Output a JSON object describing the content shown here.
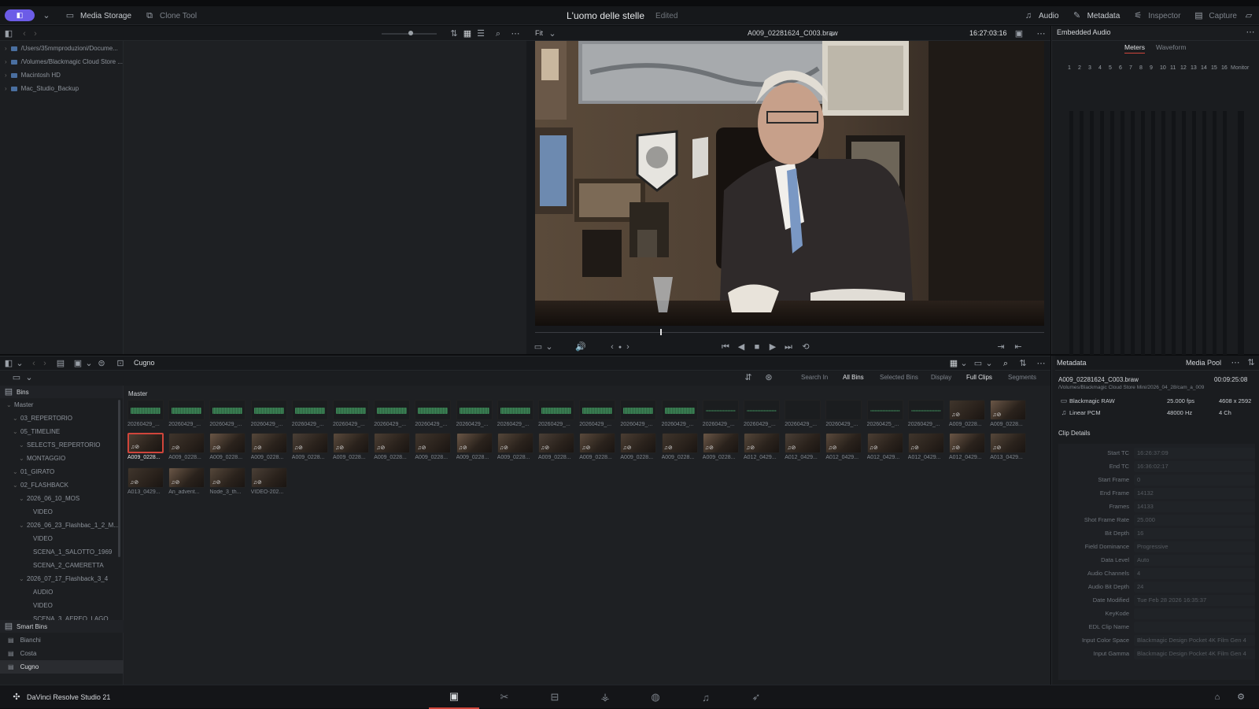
{
  "topbar": {
    "media_storage": "Media Storage",
    "clone_tool": "Clone Tool",
    "project_title": "L'uomo delle stelle",
    "edited": "Edited",
    "audio": "Audio",
    "metadata": "Metadata",
    "inspector": "Inspector",
    "capture": "Capture"
  },
  "viewer": {
    "fit": "Fit",
    "clip_name": "A009_02281624_C003.braw",
    "timecode": "16:27:03:16"
  },
  "storage": {
    "items": [
      "/Users/35mmproduzioni/Docume...",
      "/Volumes/Blackmagic Cloud Store ...",
      "Macintosh HD",
      "Mac_Studio_Backup"
    ]
  },
  "audio": {
    "title": "Embedded Audio",
    "tab_meters": "Meters",
    "tab_waveform": "Waveform",
    "monitor": "Monitor",
    "channels": [
      "1",
      "2",
      "3",
      "4",
      "5",
      "6",
      "7",
      "8",
      "9",
      "10",
      "11",
      "12",
      "13",
      "14",
      "15",
      "16"
    ]
  },
  "pool": {
    "bin_name": "Cugno",
    "master": "Master",
    "search_in": "Search In",
    "all_bins": "All Bins",
    "selected_bins": "Selected Bins",
    "display": "Display",
    "full_clips": "Full Clips",
    "segments": "Segments",
    "row1": [
      "20260429_...",
      "20260429_...",
      "20260429_...",
      "20260429_...",
      "20260429_...",
      "20260429_...",
      "20260429_...",
      "20260429_...",
      "20260429_...",
      "20260429_...",
      "20260429_...",
      "20260429_...",
      "20260429_...",
      "20260429_...",
      "20260429_...",
      "20260429_...",
      "20260429_...",
      "20260429_...",
      "20260425_...",
      "20260429_...",
      "A009_0228...",
      "A009_0228..."
    ],
    "row2": [
      "A009_0228...",
      "A009_0228...",
      "A009_0228...",
      "A009_0228...",
      "A009_0228...",
      "A009_0228...",
      "A009_0228...",
      "A009_0228...",
      "A009_0228...",
      "A009_0228...",
      "A009_0228...",
      "A009_0228...",
      "A009_0228...",
      "A009_0228...",
      "A009_0228...",
      "A012_0429...",
      "A012_0429...",
      "A012_0429...",
      "A012_0429...",
      "A012_0429...",
      "A012_0429...",
      "A013_0429..."
    ],
    "row3": [
      "A013_0429...",
      "An_advent...",
      "Node_3_th...",
      "VIDEO-202..."
    ]
  },
  "bins": {
    "header": "Bins",
    "items": [
      {
        "label": "Master",
        "indent": 0
      },
      {
        "label": "03_REPERTORIO",
        "indent": 1
      },
      {
        "label": "05_TIMELINE",
        "indent": 1
      },
      {
        "label": "SELECTS_REPERTORIO",
        "indent": 2
      },
      {
        "label": "MONTAGGIO",
        "indent": 2
      },
      {
        "label": "01_GIRATO",
        "indent": 1
      },
      {
        "label": "02_FLASHBACK",
        "indent": 1
      },
      {
        "label": "2026_06_10_MOS",
        "indent": 2
      },
      {
        "label": "VIDEO",
        "indent": 3
      },
      {
        "label": "2026_06_23_Flashbac_1_2_M...",
        "indent": 2
      },
      {
        "label": "VIDEO",
        "indent": 3
      },
      {
        "label": "SCENA_1_SALOTTO_1969",
        "indent": 3
      },
      {
        "label": "SCENA_2_CAMERETTA",
        "indent": 3
      },
      {
        "label": "2026_07_17_Flashback_3_4",
        "indent": 2
      },
      {
        "label": "AUDIO",
        "indent": 3
      },
      {
        "label": "VIDEO",
        "indent": 3
      },
      {
        "label": "SCENA_3_AEREO_LAGO",
        "indent": 3
      }
    ],
    "smart_header": "Smart Bins",
    "smart": [
      "Bianchi",
      "Costa",
      "Cugno"
    ]
  },
  "meta": {
    "title": "Metadata",
    "media_pool": "Media Pool",
    "clip": "A009_02281624_C003.braw",
    "duration": "00:09:25:08",
    "path": "/Volumes/Blackmagic Cloud Store Mini/2026_04_28/cam_a_009",
    "video_codec": "Blackmagic RAW",
    "fps": "25.000 fps",
    "res": "4608 x 2592",
    "audio_codec": "Linear PCM",
    "hz": "48000 Hz",
    "ch": "4 Ch",
    "details": "Clip Details",
    "fields": [
      {
        "k": "Start TC",
        "v": "16:26:37:09"
      },
      {
        "k": "End TC",
        "v": "16:36:02:17"
      },
      {
        "k": "Start Frame",
        "v": "0"
      },
      {
        "k": "End Frame",
        "v": "14132"
      },
      {
        "k": "Frames",
        "v": "14133"
      },
      {
        "k": "Shot Frame Rate",
        "v": "25.000"
      },
      {
        "k": "Bit Depth",
        "v": "16"
      },
      {
        "k": "Field Dominance",
        "v": "Progressive"
      },
      {
        "k": "Data Level",
        "v": "Auto"
      },
      {
        "k": "Audio Channels",
        "v": "4"
      },
      {
        "k": "Audio Bit Depth",
        "v": "24"
      },
      {
        "k": "Date Modified",
        "v": "Tue Feb 28 2026 16:35:37"
      },
      {
        "k": "KeyKode",
        "v": ""
      },
      {
        "k": "EDL Clip Name",
        "v": ""
      },
      {
        "k": "Input Color Space",
        "v": "Blackmagic Design Pocket 4K Film Gen 4"
      },
      {
        "k": "Input Gamma",
        "v": "Blackmagic Design Pocket 4K Film Gen 4"
      }
    ]
  },
  "bottom": {
    "app_name": "DaVinci Resolve Studio 21"
  },
  "colors": {
    "accent": "#d0453b",
    "brand": "#6c5ce7",
    "waveform": "#3f8a5a"
  }
}
